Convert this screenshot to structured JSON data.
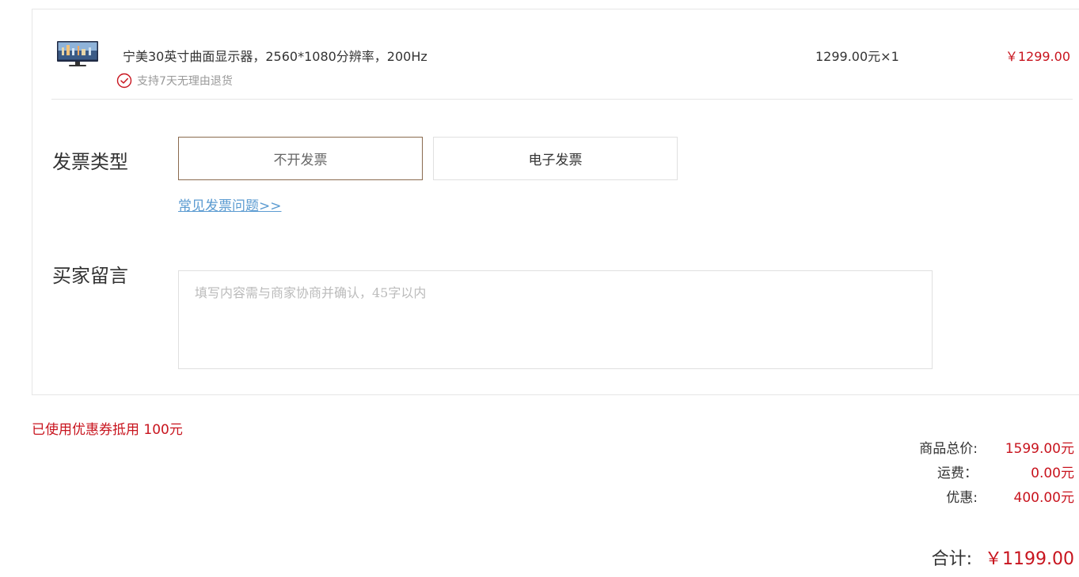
{
  "product": {
    "name": "宁美30英寸曲面显示器，2560*1080分辨率，200Hz",
    "return_policy": "支持7天无理由退货",
    "unit_price": "1299.00元×1",
    "subtotal": "￥1299.00",
    "thumbnail_icon": "monitor-thumbnail"
  },
  "invoice": {
    "label": "发票类型",
    "options": [
      "不开发票",
      "电子发票"
    ],
    "selected": "不开发票",
    "faq_link": "常见发票问题>>"
  },
  "message": {
    "label": "买家留言",
    "placeholder": "填写内容需与商家协商并确认，45字以内"
  },
  "coupon_note": "已使用优惠券抵用 100元",
  "summary": {
    "items_total_label": "商品总价:",
    "items_total_value": "1599.00元",
    "shipping_label": "运费：",
    "shipping_value": "0.00元",
    "discount_label": "优惠:",
    "discount_value": "400.00元",
    "grand_total_label": "合计:",
    "grand_total_value": "￥1199.00"
  },
  "colors": {
    "price_red": "#c8141e",
    "link_blue": "#5b9bd1",
    "selected_border": "#8a6a4e",
    "border_gray": "#e6e6e6"
  }
}
